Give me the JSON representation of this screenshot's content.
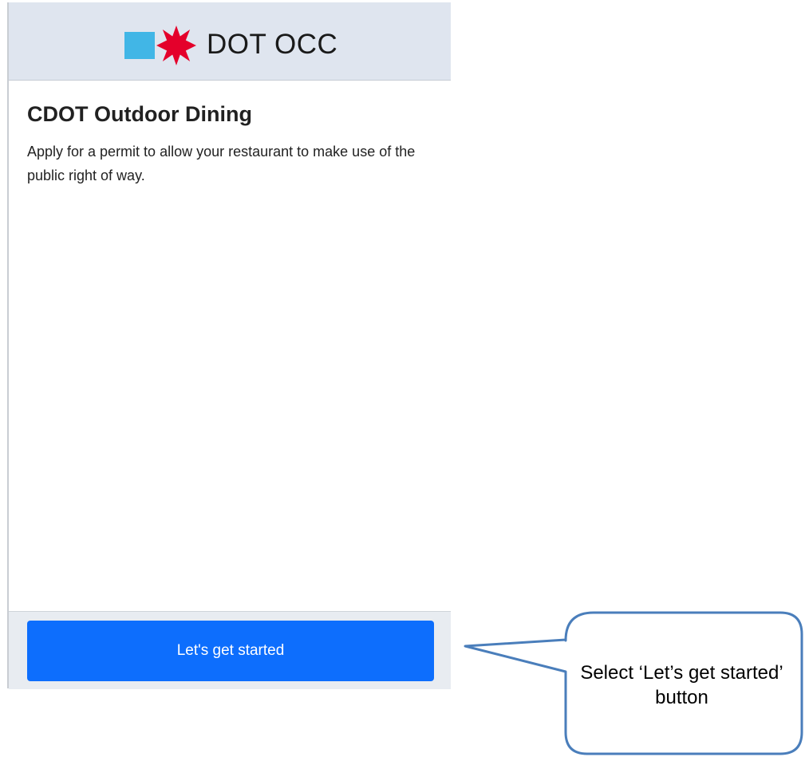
{
  "header": {
    "title": "DOT OCC",
    "logo_square_color": "#41b6e6",
    "logo_star_color": "#e4002b",
    "background": "#dfe5ef"
  },
  "main": {
    "title": "CDOT Outdoor Dining",
    "description": "Apply for a permit to allow your restaurant to make use of the public right of way."
  },
  "footer": {
    "button_label": "Let's get started",
    "button_color": "#0d6efd"
  },
  "annotation": {
    "text": "Select ‘Let’s get started’ button",
    "border_color": "#4a7ebb"
  }
}
